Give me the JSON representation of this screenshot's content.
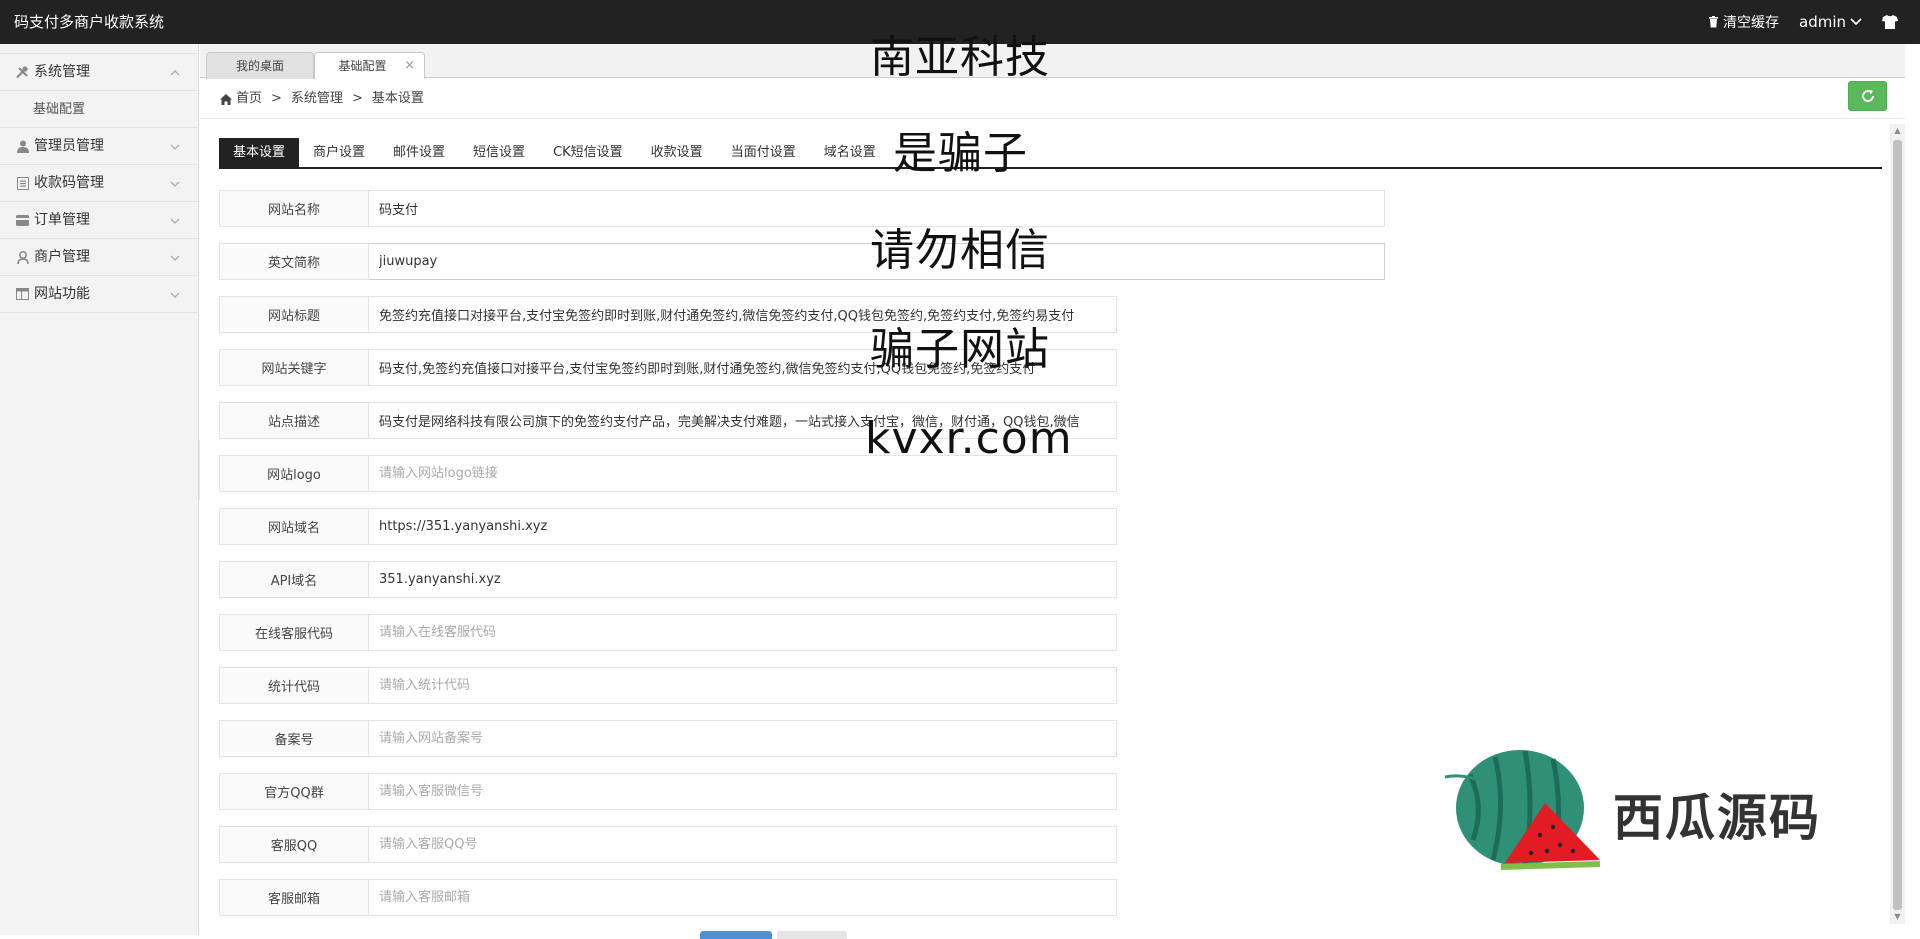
{
  "app": {
    "title": "码支付多商户收款系统"
  },
  "topbar": {
    "clear_cache": "清空缓存",
    "user": "admin"
  },
  "sidebar": {
    "items": [
      {
        "label": "系统管理",
        "icon": "tools-icon",
        "expanded": true,
        "children": [
          "基础配置"
        ]
      },
      {
        "label": "管理员管理",
        "icon": "user-icon"
      },
      {
        "label": "收款码管理",
        "icon": "list-icon"
      },
      {
        "label": "订单管理",
        "icon": "card-icon"
      },
      {
        "label": "商户管理",
        "icon": "merchant-icon"
      },
      {
        "label": "网站功能",
        "icon": "grid-icon"
      }
    ]
  },
  "tabs": [
    {
      "label": "我的桌面"
    },
    {
      "label": "基础配置",
      "active": true
    }
  ],
  "breadcrumb": [
    "首页",
    "系统管理",
    "基本设置"
  ],
  "settings_tabs": [
    "基本设置",
    "商户设置",
    "邮件设置",
    "短信设置",
    "CK短信设置",
    "收款设置",
    "当面付设置",
    "域名设置"
  ],
  "form": {
    "fields": [
      {
        "label": "网站名称",
        "value": "码支付",
        "placeholder": ""
      },
      {
        "label": "英文简称",
        "value": "jiuwupay",
        "placeholder": ""
      },
      {
        "label": "网站标题",
        "value": "免签约充值接口对接平台,支付宝免签约即时到账,财付通免签约,微信免签约支付,QQ钱包免签约,免签约支付,免签约易支付",
        "placeholder": ""
      },
      {
        "label": "网站关键字",
        "value": "码支付,免签约充值接口对接平台,支付宝免签约即时到账,财付通免签约,微信免签约支付,QQ钱包免签约,免签约支付",
        "placeholder": ""
      },
      {
        "label": "站点描述",
        "value": "码支付是网络科技有限公司旗下的免签约支付产品，完美解决支付难题，一站式接入支付宝，微信，财付通，QQ钱包,微信",
        "placeholder": ""
      },
      {
        "label": "网站logo",
        "value": "",
        "placeholder": "请输入网站logo链接"
      },
      {
        "label": "网站域名",
        "value": "https://351.yanyanshi.xyz",
        "placeholder": ""
      },
      {
        "label": "API域名",
        "value": "351.yanyanshi.xyz",
        "placeholder": ""
      },
      {
        "label": "在线客服代码",
        "value": "",
        "placeholder": "请输入在线客服代码"
      },
      {
        "label": "统计代码",
        "value": "",
        "placeholder": "请输入统计代码"
      },
      {
        "label": "备案号",
        "value": "",
        "placeholder": "请输入网站备案号"
      },
      {
        "label": "官方QQ群",
        "value": "",
        "placeholder": "请输入客服微信号"
      },
      {
        "label": "客服QQ",
        "value": "",
        "placeholder": "请输入客服QQ号"
      },
      {
        "label": "客服邮箱",
        "value": "",
        "placeholder": "请输入客服邮箱"
      }
    ]
  },
  "watermark": [
    "南亚科技",
    "是骗子",
    "请勿相信",
    "骗子网站",
    "kvxr.com"
  ],
  "brand": {
    "text": "西瓜源码"
  }
}
